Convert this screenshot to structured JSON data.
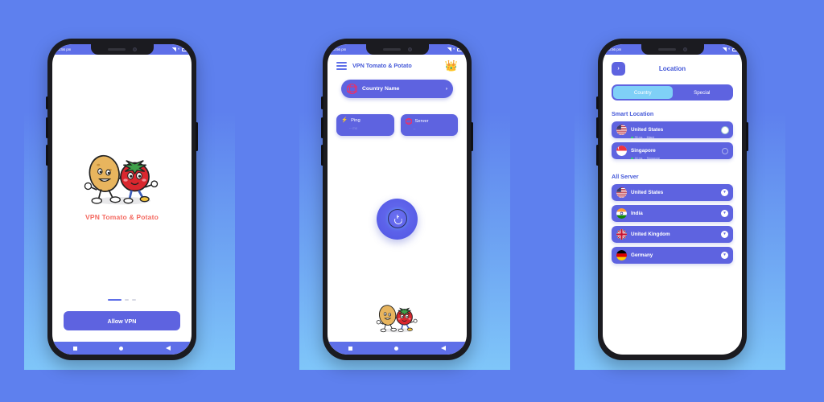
{
  "app": {
    "name": "VPN Tomato & Potato",
    "brand_color": "#5E63E0",
    "title_color": "#4458D8",
    "logo_text_color": "#F4685F"
  },
  "status_bar": {
    "time": "10:56 pm",
    "signal": "signal-icon",
    "wifi": "wifi-icon",
    "battery": "battery-icon"
  },
  "nav_bar": {
    "recent": "square-icon",
    "home": "circle-icon",
    "back": "triangle-icon"
  },
  "screen1": {
    "logo_text": "VPN Tomato & Potato",
    "allow_button": "Allow VPN",
    "page_indicator": {
      "active": 1,
      "total": 3
    }
  },
  "screen2": {
    "menu_icon": "hamburger-icon",
    "title": "VPN Tomato & Potato",
    "premium_icon": "crown-icon",
    "country_selector": {
      "icon": "globe-icon",
      "label": "Country Name",
      "chevron": "›"
    },
    "stats": [
      {
        "icon": "bolt-icon",
        "label": "Ping",
        "value": "-- ms"
      },
      {
        "icon": "globe-icon",
        "label": "Server",
        "value": "--"
      }
    ],
    "power_button": {
      "icon": "power-icon",
      "state": "off"
    }
  },
  "screen3": {
    "back_icon": "›",
    "title": "Location",
    "tabs": [
      {
        "label": "Country",
        "active": true
      },
      {
        "label": "Special",
        "active": false
      }
    ],
    "sections": [
      {
        "title": "Smart Location",
        "type": "smart",
        "items": [
          {
            "name": "United States",
            "flag": "us-flag-icon",
            "ping": "35 ms",
            "city": "Miami",
            "selected": true
          },
          {
            "name": "Singapore",
            "flag": "sg-flag-icon",
            "ping": "44 ms",
            "city": "Singapore",
            "selected": false
          }
        ]
      },
      {
        "title": "All Server",
        "type": "list",
        "items": [
          {
            "name": "United States",
            "flag": "us-flag-icon",
            "chevron": "∨"
          },
          {
            "name": "India",
            "flag": "in-flag-icon",
            "chevron": "∨"
          },
          {
            "name": "United Kingdom",
            "flag": "gb-flag-icon",
            "chevron": "∨"
          },
          {
            "name": "Germany",
            "flag": "de-flag-icon",
            "chevron": "∨"
          }
        ]
      }
    ]
  }
}
